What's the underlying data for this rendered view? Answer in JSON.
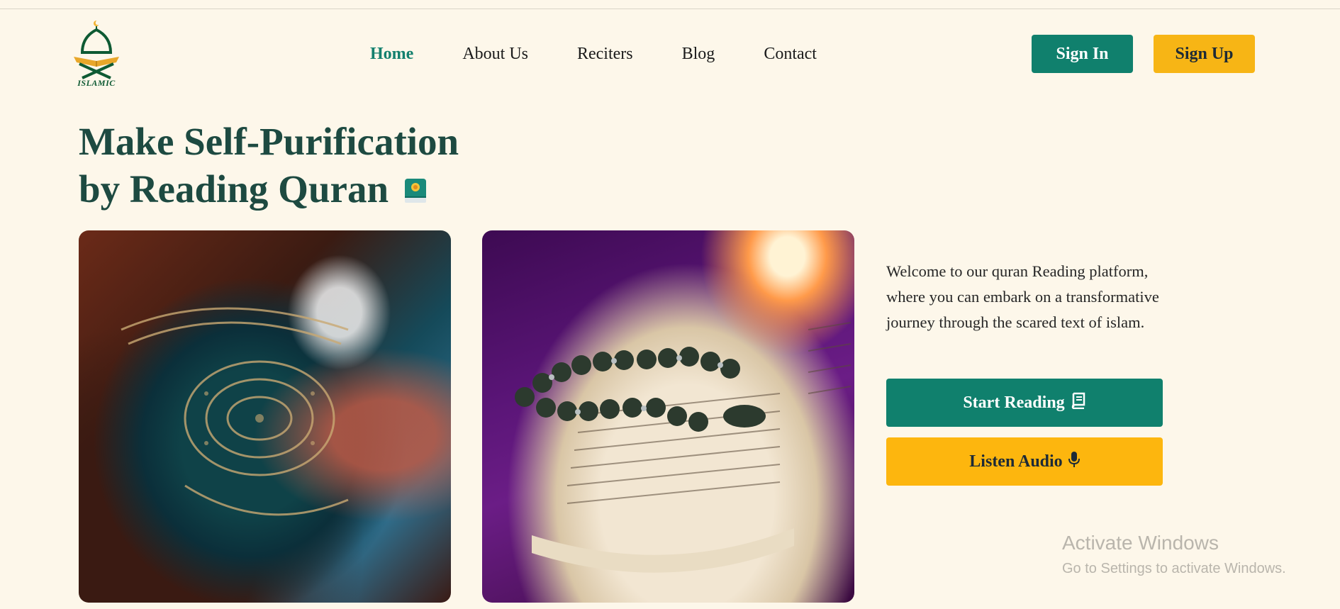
{
  "brand": {
    "logo_text": "ISLAMIC",
    "primary": "#10806d",
    "accent": "#f7b515",
    "background": "#fdf7ea"
  },
  "nav": {
    "items": [
      {
        "label": "Home",
        "active": true
      },
      {
        "label": "About Us",
        "active": false
      },
      {
        "label": "Reciters",
        "active": false
      },
      {
        "label": "Blog",
        "active": false
      },
      {
        "label": "Contact",
        "active": false
      }
    ]
  },
  "auth": {
    "sign_in": "Sign In",
    "sign_up": "Sign Up"
  },
  "hero": {
    "title_line1": "Make Self-Purification",
    "title_line2": "by Reading Quran",
    "title_icon": "book-emoji-icon",
    "intro": "Welcome to our quran Reading platform, where you can embark on a transformative journey through the scared text of islam.",
    "start_reading": "Start Reading",
    "start_reading_icon": "book-icon",
    "listen_audio": "Listen Audio",
    "listen_audio_icon": "microphone-icon",
    "images": [
      {
        "name": "quran-cover-photo"
      },
      {
        "name": "open-quran-with-prayer-beads-photo"
      }
    ]
  },
  "watermark": {
    "title": "Activate Windows",
    "subtitle": "Go to Settings to activate Windows."
  }
}
